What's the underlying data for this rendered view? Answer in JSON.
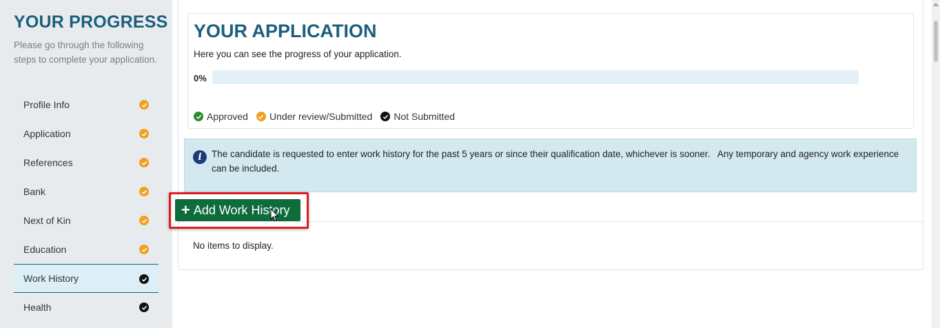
{
  "sidebar": {
    "title": "YOUR PROGRESS",
    "description": "Please go through the following steps to complete your application.",
    "steps": [
      {
        "label": "Profile Info",
        "status": "under-review",
        "icon": "check-circle-orange-icon"
      },
      {
        "label": "Application",
        "status": "under-review",
        "icon": "check-circle-orange-icon"
      },
      {
        "label": "References",
        "status": "under-review",
        "icon": "check-circle-orange-icon"
      },
      {
        "label": "Bank",
        "status": "under-review",
        "icon": "check-circle-orange-icon"
      },
      {
        "label": "Next of Kin",
        "status": "under-review",
        "icon": "check-circle-orange-icon"
      },
      {
        "label": "Education",
        "status": "under-review",
        "icon": "check-circle-orange-icon"
      },
      {
        "label": "Work History",
        "status": "not-submitted",
        "icon": "check-circle-black-icon",
        "active": true
      },
      {
        "label": "Health",
        "status": "not-submitted",
        "icon": "check-circle-black-icon"
      }
    ]
  },
  "application": {
    "title": "YOUR APPLICATION",
    "description": "Here you can see the progress of your application.",
    "progress_label": "0%",
    "progress_value": 0,
    "legend": [
      {
        "label": "Approved",
        "icon": "check-circle-green-icon"
      },
      {
        "label": "Under review/Submitted",
        "icon": "check-circle-orange-icon"
      },
      {
        "label": "Not Submitted",
        "icon": "check-circle-black-icon"
      }
    ]
  },
  "info": {
    "icon": "info-icon",
    "text": "The candidate is requested to enter work history for the past 5 years or since their qualification date, whichever is sooner.   Any temporary and agency work experience can be included."
  },
  "work_history": {
    "add_button_label": "Add Work History",
    "empty_text": "No items to display."
  },
  "colors": {
    "brand": "#1b5f7d",
    "button": "#0e6b3c",
    "status_approved": "#2e8b2e",
    "status_review": "#f0a020",
    "status_not_submitted": "#111111",
    "highlight": "#e01b1b"
  }
}
